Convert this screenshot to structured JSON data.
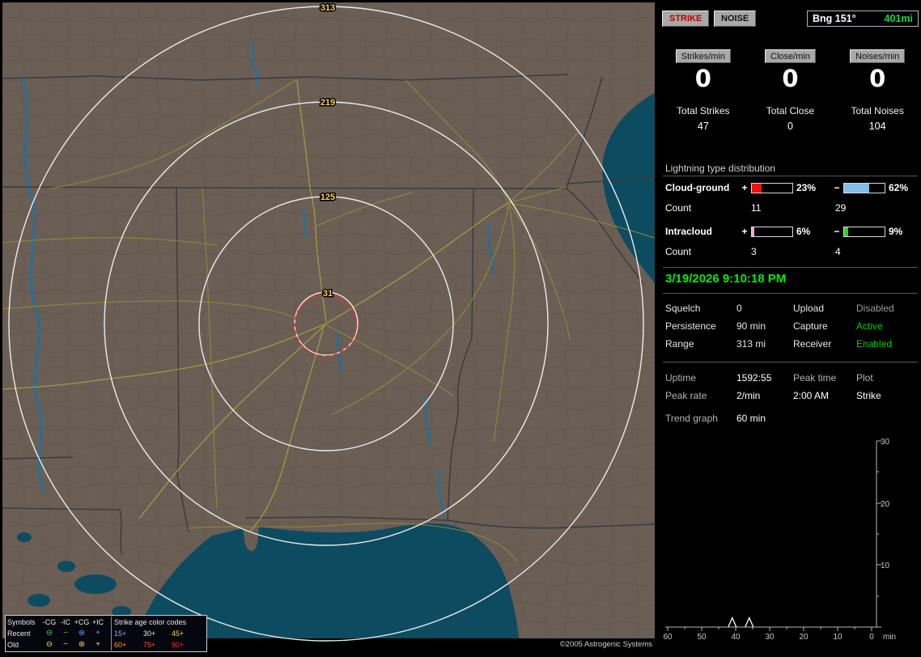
{
  "map": {
    "ring_labels": [
      "313",
      "219",
      "125",
      "31"
    ],
    "ring_color": "#ececec",
    "close_alarm_color": "#ff2a2a",
    "copyright": "©2005 Astrogenic Systems",
    "legend": {
      "symbols_title": "Symbols",
      "col_headers": [
        "-CG",
        "-IC",
        "+CG",
        "+IC"
      ],
      "age_title": "Strike age color codes",
      "rows": [
        {
          "label": "Recent",
          "symbols": [
            {
              "glyph": "⊖",
              "color": "#58c858"
            },
            {
              "glyph": "−",
              "color": "#58c858"
            },
            {
              "glyph": "⊕",
              "color": "#5b9bff"
            },
            {
              "glyph": "+",
              "color": "#5b9bff"
            }
          ],
          "ages": [
            {
              "text": "15+",
              "color": "#8cb0ff"
            },
            {
              "text": "30+",
              "color": "#e8e8e8"
            },
            {
              "text": "45+",
              "color": "#ffd24a"
            }
          ]
        },
        {
          "label": "Old",
          "symbols": [
            {
              "glyph": "⊖",
              "color": "#ffd24a"
            },
            {
              "glyph": "−",
              "color": "#ffd24a"
            },
            {
              "glyph": "⊕",
              "color": "#ffd24a"
            },
            {
              "glyph": "+",
              "color": "#ffd24a"
            }
          ],
          "ages": [
            {
              "text": "60+",
              "color": "#ff9a2a"
            },
            {
              "text": "75+",
              "color": "#ff5522"
            },
            {
              "text": "90+",
              "color": "#ff2a2a"
            }
          ]
        }
      ]
    }
  },
  "panel": {
    "strike_button": "STRIKE",
    "strike_color": "#bb0000",
    "noise_button": "NOISE",
    "bearing": "Bng 151°",
    "range": "401mi",
    "range_color": "#00dd44",
    "rates": [
      {
        "label": "Strikes/min",
        "value": "0"
      },
      {
        "label": "Close/min",
        "value": "0"
      },
      {
        "label": "Noises/min",
        "value": "0"
      }
    ],
    "totals": [
      {
        "label": "Total Strikes",
        "value": "47"
      },
      {
        "label": "Total Close",
        "value": "0"
      },
      {
        "label": "Total Noises",
        "value": "104"
      }
    ],
    "distribution": {
      "title": "Lightning type distribution",
      "plus_sign": "+",
      "minus_sign": "−",
      "rows": [
        {
          "name": "Cloud-ground",
          "count_label": "Count",
          "plus_pct": "23%",
          "plus_fill": "23%",
          "plus_color": "#ee1111",
          "plus_count": "11",
          "minus_pct": "62%",
          "minus_fill": "62%",
          "minus_color": "#85bbe8",
          "minus_count": "29"
        },
        {
          "name": "Intracloud",
          "count_label": "Count",
          "plus_pct": "6%",
          "plus_fill": "6%",
          "plus_color": "#f2a6dc",
          "plus_count": "3",
          "minus_pct": "9%",
          "minus_fill": "9%",
          "minus_color": "#33cc33",
          "minus_count": "4"
        }
      ]
    },
    "datetime": "3/19/2026 9:10:18 PM",
    "datetime_color": "#00ee00",
    "settings": [
      {
        "label": "Squelch",
        "value": "0",
        "label2": "Upload",
        "value2": "Disabled",
        "value2_color": "#9a9a9a"
      },
      {
        "label": "Persistence",
        "value": "90 min",
        "label2": "Capture",
        "value2": "Active",
        "value2_color": "#00cc00"
      },
      {
        "label": "Range",
        "value": "313 mi",
        "label2": "Receiver",
        "value2": "Enabled",
        "value2_color": "#00cc00"
      }
    ],
    "info_rows": [
      [
        "Uptime",
        "1592:55",
        "Peak time",
        "Plot"
      ],
      [
        "Peak rate",
        "2/min",
        "2:00 AM",
        "Strike"
      ]
    ],
    "trend": {
      "label": "Trend graph",
      "value": "60 min"
    },
    "chart_data": {
      "type": "line",
      "title": "Trend graph (strikes per minute, last 60 min)",
      "x_ticks": [
        "60",
        "50",
        "40",
        "30",
        "20",
        "10",
        "0"
      ],
      "x_unit": "min",
      "y_ticks": [
        "30",
        "20",
        "10"
      ],
      "ylim": [
        0,
        30
      ],
      "xlim_minutes_ago": [
        60,
        0
      ],
      "series": [
        {
          "name": "Strikes/min",
          "spikes": [
            {
              "t_minutes_ago": 41,
              "value": 1.5
            },
            {
              "t_minutes_ago": 36,
              "value": 1.5
            }
          ]
        }
      ]
    }
  }
}
